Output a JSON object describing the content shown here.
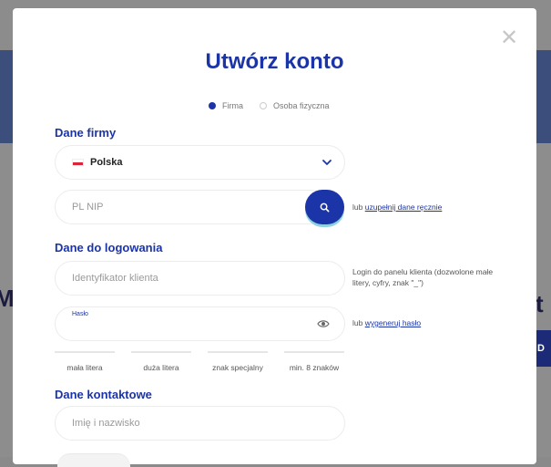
{
  "modal": {
    "close_symbol": "✕",
    "title": "Utwórz konto",
    "account_types": [
      {
        "label": "Firma",
        "selected": true
      },
      {
        "label": "Osoba fizyczna",
        "selected": false
      }
    ]
  },
  "company": {
    "section_title": "Dane firmy",
    "country": {
      "value": "Polska",
      "flag_icon": "poland-flag-icon",
      "chevron_icon": "chevron-down-icon"
    },
    "nip": {
      "placeholder": "PL NIP",
      "search_icon": "search-icon"
    },
    "manual_prefix": "lub ",
    "manual_link": "uzupełnij dane ręcznie"
  },
  "login": {
    "section_title": "Dane do logowania",
    "client_id": {
      "placeholder": "Identyfikator klienta"
    },
    "client_id_hint": "Login do panelu klienta (dozwolone małe litery, cyfry, znak \"_\")",
    "password": {
      "label": "Hasło",
      "value": "",
      "eye_icon": "eye-icon"
    },
    "generate_prefix": "lub ",
    "generate_link": "wygeneruj hasło",
    "strength_rules": [
      "mała litera",
      "duża litera",
      "znak specjalny",
      "min. 8 znaków"
    ]
  },
  "contact": {
    "section_title": "Dane kontaktowe",
    "name": {
      "placeholder": "Imię i nazwisko"
    }
  },
  "colors": {
    "accent": "#1b34a8",
    "overlay": "#8a8a8a"
  }
}
